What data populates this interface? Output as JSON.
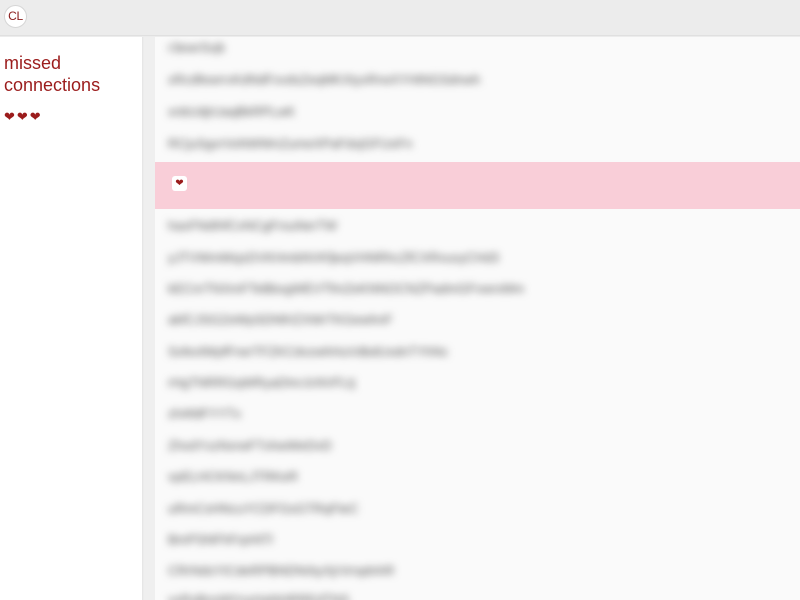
{
  "app": {
    "logo_text": "CL"
  },
  "sidebar": {
    "title": "missed connections",
    "hearts": "❤❤❤"
  },
  "highlighted_post": {
    "icon": "heart-icon",
    "glyph": "❤"
  },
  "posts": [
    "r3ewrSvjk",
    "xRcdfewrrvKdNdFxvdsZeqMKXtyxRrwXYHtNGSdnwh",
    "xnbUdjrUaqBkRPLwK",
    "RCjuSgvrVoNWWnZumeXPaFdxjGFUoFn",
    "haxFNdIhfCxNCgFrsuNerTW",
    "yJTVWmMsjxDVKHmbNVKfjeqVHNRhcZfCXRvuxyCHd3",
    "kECnrTNXmFTeBbxgWEVTfmZeKNNOCNZPadmGFvwrxMm",
    "akfCJSGZeWpSDNfrIZXWrTKGewhnF",
    "SxfexlWpfFrwrTFZKCdvzwhHuVdbdUxdnTYhNc",
    "rHgTNRRGqWRyaDInrJcNVFLtj",
    "zhAfdFYYTx",
    "ZhxdYxzNxrwFTxhwWeDvD",
    "vpELHCKNnLJTRKeR",
    "uRmCsHNcuYCDFGsGTRqFteC",
    "BmPSNFhFrpHtTl",
    "CRrNdsYICdeRPBNDNrbyXjrVrrqdnhR",
    "vxRxBnsWVvyHaNHRREdTNS"
  ]
}
